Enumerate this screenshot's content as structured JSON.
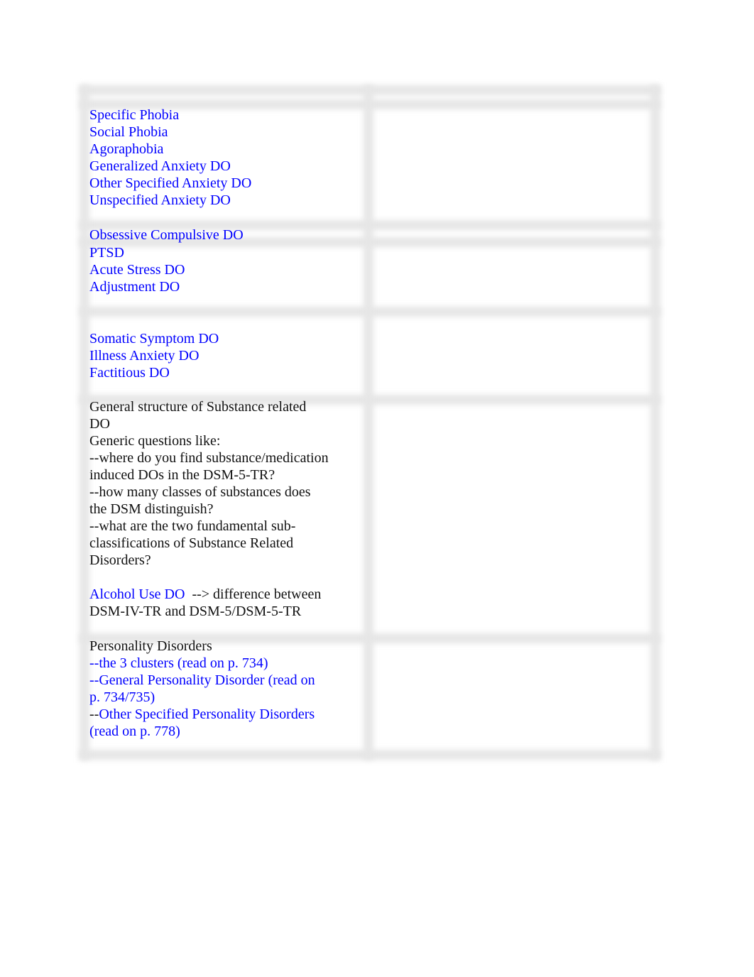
{
  "document": {
    "table": {
      "columns": 2,
      "rows": [
        {
          "id": "anxiety",
          "left_lines": [
            [
              {
                "text": "Specific Phobia",
                "color": "blue"
              }
            ],
            [
              {
                "text": "Social Phobia",
                "color": "blue"
              }
            ],
            [
              {
                "text": "Agoraphobia",
                "color": "blue"
              }
            ],
            [
              {
                "text": "Generalized Anxiety DO",
                "color": "blue"
              }
            ],
            [
              {
                "text": "Other Specified Anxiety DO",
                "color": "blue"
              }
            ],
            [
              {
                "text": "Unspecified Anxiety DO",
                "color": "blue"
              }
            ]
          ],
          "right": ""
        },
        {
          "id": "ocd",
          "left_lines": [
            [
              {
                "text": "Obsessive Compulsive DO",
                "color": "blue"
              }
            ]
          ],
          "right": ""
        },
        {
          "id": "trauma",
          "left_lines": [
            [
              {
                "text": "PTSD",
                "color": "blue"
              }
            ],
            [
              {
                "text": "Acute Stress DO",
                "color": "blue"
              }
            ],
            [
              {
                "text": "Adjustment DO",
                "color": "blue"
              }
            ]
          ],
          "right": ""
        },
        {
          "id": "somatic",
          "left_lines": [
            [
              {
                "text": "Somatic Symptom DO",
                "color": "blue"
              }
            ],
            [
              {
                "text": "Illness Anxiety DO",
                "color": "blue"
              }
            ],
            [
              {
                "text": "Factitious DO",
                "color": "blue"
              }
            ]
          ],
          "right": ""
        },
        {
          "id": "substance",
          "left_lines": [
            [
              {
                "text": "General structure of Substance related",
                "color": "black"
              }
            ],
            [
              {
                "text": "DO",
                "color": "black"
              }
            ],
            [
              {
                "text": "Generic questions like:",
                "color": "black"
              }
            ],
            [
              {
                "text": "--where do you find substance/medication",
                "color": "black"
              }
            ],
            [
              {
                "text": "induced DOs in the DSM-5-TR?",
                "color": "black"
              }
            ],
            [
              {
                "text": "--how many classes of substances does",
                "color": "black"
              }
            ],
            [
              {
                "text": "the DSM distinguish?",
                "color": "black"
              }
            ],
            [
              {
                "text": "--what are the two fundamental sub-",
                "color": "black"
              }
            ],
            [
              {
                "text": "classifications of Substance Related",
                "color": "black"
              }
            ],
            [
              {
                "text": "Disorders?",
                "color": "black"
              }
            ],
            [],
            [
              {
                "text": "Alcohol Use DO",
                "color": "blue"
              },
              {
                "text": "  --> difference between",
                "color": "black"
              }
            ],
            [
              {
                "text": "DSM-IV-TR and DSM-5/DSM-5-TR",
                "color": "black"
              }
            ]
          ],
          "right": ""
        },
        {
          "id": "personality",
          "left_lines": [
            [
              {
                "text": "Personality Disorders",
                "color": "black"
              }
            ],
            [
              {
                "text": "--the 3 clusters (read on p. 734)",
                "color": "blue"
              }
            ],
            [
              {
                "text": "--General Personality Disorder (read on",
                "color": "blue"
              }
            ],
            [
              {
                "text": "p. 734/735)",
                "color": "blue"
              }
            ],
            [
              {
                "text": "--",
                "color": "black"
              },
              {
                "text": "Other Specified Personality Disorders",
                "color": "blue"
              }
            ],
            [
              {
                "text": "(read on p. 778)",
                "color": "blue"
              }
            ]
          ],
          "right": ""
        }
      ]
    }
  }
}
